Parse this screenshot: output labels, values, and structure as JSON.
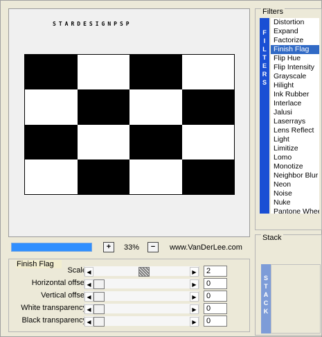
{
  "preview": {
    "brand": "STARDESIGNPSP",
    "flag_pattern": [
      [
        "black",
        "white",
        "black",
        "white"
      ],
      [
        "white",
        "black",
        "white",
        "black"
      ],
      [
        "black",
        "white",
        "black",
        "white"
      ],
      [
        "white",
        "black",
        "white",
        "black"
      ]
    ]
  },
  "zoom": {
    "zoom_in_label": "+",
    "zoom_out_label": "−",
    "value": "33%",
    "website": "www.VanDerLee.com"
  },
  "params": {
    "title": "Finish Flag",
    "rows": [
      {
        "label": "Scale",
        "value": "2"
      },
      {
        "label": "Horizontal offset",
        "value": "0"
      },
      {
        "label": "Vertical offset",
        "value": "0"
      },
      {
        "label": "White transparency",
        "value": "0"
      },
      {
        "label": "Black transparency",
        "value": "0"
      }
    ]
  },
  "filters": {
    "title": "Filters",
    "sidebar_label": "F I L T E R S",
    "items": [
      "Distortion",
      "Expand",
      "Factorize",
      "Finish Flag",
      "Flip Hue",
      "Flip Intensity",
      "Grayscale",
      "Hilight",
      "Ink Rubber",
      "Interlace",
      "Jalusi",
      "Laserrays",
      "Lens Reflect",
      "Light",
      "Limitize",
      "Lomo",
      "Monotize",
      "Neighbor Blur",
      "Neon",
      "Noise",
      "Nuke",
      "Pantone Wheel"
    ],
    "selected": "Finish Flag"
  },
  "stack": {
    "title": "Stack",
    "sidebar_label": "S T A C K"
  },
  "colors": {
    "selection": "#316ac5",
    "filters_bar": "#1a4fd4",
    "progress": "#2f8fff"
  }
}
